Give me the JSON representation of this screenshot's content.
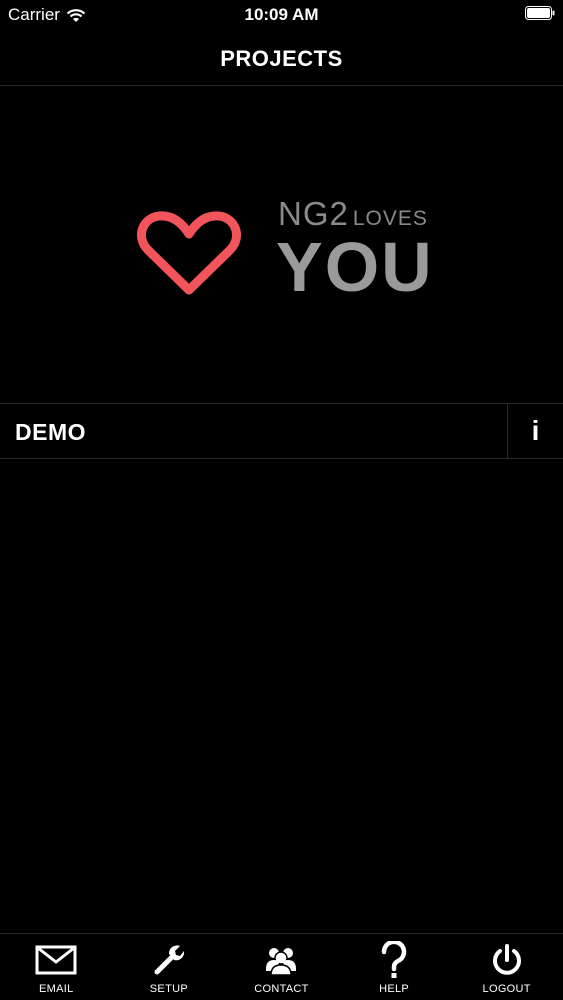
{
  "status_bar": {
    "carrier": "Carrier",
    "time": "10:09 AM",
    "wifi_icon": "wifi-icon",
    "battery_icon": "battery-icon"
  },
  "nav": {
    "title": "PROJECTS"
  },
  "logo": {
    "line1_main": "NG2",
    "line1_small": "LOVES",
    "line2": "YOU",
    "heart_color": "#f2545b",
    "text_color": "#9a9a9a"
  },
  "projects": [
    {
      "name": "DEMO",
      "info_label": "i"
    }
  ],
  "tabs": [
    {
      "label": "EMAIL",
      "icon": "envelope-icon"
    },
    {
      "label": "SETUP",
      "icon": "wrench-icon"
    },
    {
      "label": "CONTACT",
      "icon": "people-icon"
    },
    {
      "label": "HELP",
      "icon": "question-icon"
    },
    {
      "label": "LOGOUT",
      "icon": "power-icon"
    }
  ]
}
